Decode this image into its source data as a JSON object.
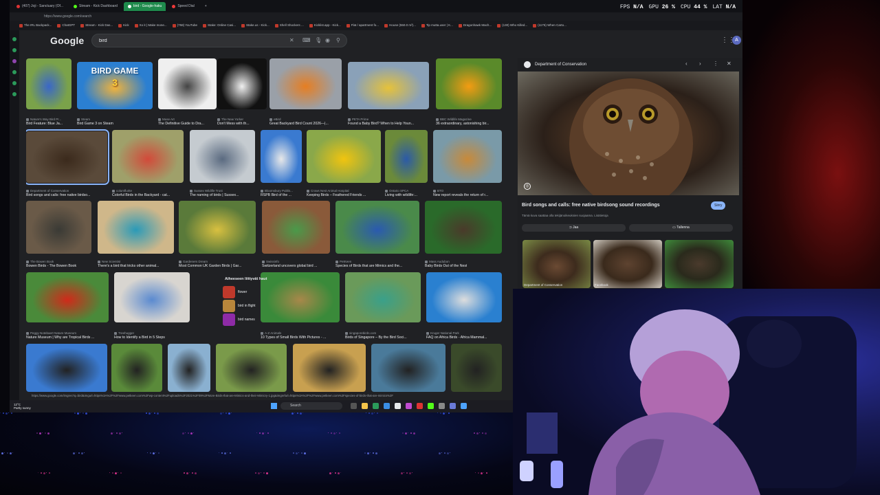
{
  "tabs": [
    {
      "label": "(407) Joji - Sanctuary (Of...",
      "active": false
    },
    {
      "label": "Stream - Kick Dashboard",
      "active": false
    },
    {
      "label": "bird - Google-haku",
      "active": true
    },
    {
      "label": "Speed Dial",
      "active": false
    }
  ],
  "address": "https://www.google.com/search",
  "bookmarks": [
    "The IRL Backpack...",
    "ChatGPT",
    "Stream - Kick Das...",
    "Kick",
    "Xo it | Make mone...",
    "(758) YouTube",
    "Stake: Online Casi...",
    "Stake.us - Kick...",
    "Shell Shockers ...",
    "Kicklist.app - Kick...",
    "Flat / apartment fo...",
    "House (550.0 m²)...",
    "Tip mutta.user | K...",
    "Dragonhawk Mach...",
    "(130) Who Killed...",
    "(1175) When Carto..."
  ],
  "hud": {
    "fps_label": "FPS",
    "fps": "N/A",
    "gpu_label": "GPU",
    "gpu": "26 %",
    "cpu_label": "CPU",
    "cpu": "44 %",
    "lat_label": "LAT",
    "lat": "N/A"
  },
  "google": {
    "logo": "Google",
    "query": "bird",
    "avatar_letter": "A"
  },
  "results": [
    {
      "source": "Nature's Way Bird Pr...",
      "caption": "Bird Feature: Blue Ja..."
    },
    {
      "source": "Steam",
      "caption": "Bird Game 3 on Steam"
    },
    {
      "source": "Muse Art",
      "caption": "The Definitive Guide to Dra..."
    },
    {
      "source": "The New Yorker",
      "caption": "Don't Mess with th..."
    },
    {
      "source": "eBird",
      "caption": "Great Backyard Bird Count 2026—|..."
    },
    {
      "source": "PETA Prime",
      "caption": "Found a Baby Bird? When to Help Youn..."
    },
    {
      "source": "BBC Wildlife Magazine",
      "caption": "36 extraordinary, astonishing bir..."
    },
    {
      "source": "Department of Conservation",
      "caption": "Bird songs and calls: free native birdso..."
    },
    {
      "source": "columflurite",
      "caption": "Colorful Birds in the Backyard - cat..."
    },
    {
      "source": "Sussex Wildlife Trust",
      "caption": "The naming of birds | Sussex..."
    },
    {
      "source": "Bloomsbury Publis...",
      "caption": "RSPB Bird of the ..."
    },
    {
      "source": "Crows Nest Animal Hospital",
      "caption": "Keeping Birds – Feathered Friends ..."
    },
    {
      "source": "Ontario SPCA",
      "caption": "Living with wildlife:..."
    },
    {
      "source": "BTO",
      "caption": "New report reveals the return of r..."
    },
    {
      "source": "The Bowen Book",
      "caption": "Bowen Birds - The Bowen Book"
    },
    {
      "source": "New Scientist",
      "caption": "There's a bird that tricks other animal..."
    },
    {
      "source": "Gardeners Dream",
      "caption": "Most Common UK Garden Birds | Gar..."
    },
    {
      "source": "Swissinfo",
      "caption": "Switzerland uncovers global bird ..."
    },
    {
      "source": "PetKeen",
      "caption": "Species of Birds that are Mimics and the..."
    },
    {
      "source": "Mass Audubon",
      "caption": "Baby Birds Out of the Nest"
    },
    {
      "source": "Peggy Notebaert Nature Museum",
      "caption": "Nature Museum | Why are Tropical Birds ..."
    },
    {
      "source": "Treehugger",
      "caption": "How to Identify a Bird in 5 Steps"
    },
    {
      "source": "A-Z Animals",
      "caption": "10 Types of Small Birds With Pictures - ..."
    },
    {
      "source": "singaporebirds.com",
      "caption": "Birds of Singapore – By the Bird Soci..."
    },
    {
      "source": "Kruger National Park",
      "caption": "FAQ on Africa Birds - Africa Mammal..."
    }
  ],
  "bird_game_text": "BIRD GAME",
  "bird_game_number": "3",
  "related": {
    "title": "Aiheeseen liittyvät haut",
    "items": [
      "flower",
      "bird in flight",
      "bird names"
    ]
  },
  "panel": {
    "source": "Department of Conservation",
    "title": "Bird songs and calls: free native birdsong sound recordings",
    "visit": "Siirry",
    "subtitle": "Tämä kuva saattaa olla tekijänoikeuksien suojaama. Lisätietoja",
    "share": "Jaa",
    "save": "Tallenna",
    "related_sources": [
      "Department of Conservation",
      "Facebook"
    ]
  },
  "status_url": "https://www.google.com/imgres?q=bird&imgurl=https%3A%2F%2Fwww.petkeen.com%2Fwp-content%2Fuploads%2F2021%2F09%2FMore-Birds-that-are-Mimics-and-their-Mimicry-1.jpg&imgrefurl=https%3A%2F%2Fwww.petkeen.com%2Fspecies-of-birds-that-are-mimics%2F",
  "taskbar": {
    "search": "Search",
    "temp": "12°C",
    "weather": "Partly sunny"
  }
}
